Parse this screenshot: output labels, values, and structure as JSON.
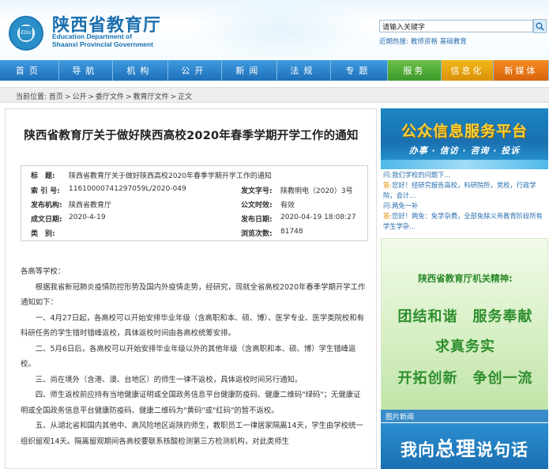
{
  "header": {
    "title_cn": "陕西省教育厅",
    "title_en_1": "Education Department of",
    "title_en_2": "Shaanxi Provincial Government",
    "search_placeholder": "请输入关键字",
    "hot_label": "近期热搜:",
    "hot_links": [
      "教师资格",
      "基础教育"
    ]
  },
  "nav": [
    {
      "label": "首页"
    },
    {
      "label": "导航"
    },
    {
      "label": "机构"
    },
    {
      "label": "公开"
    },
    {
      "label": "新闻"
    },
    {
      "label": "法规"
    },
    {
      "label": "专题"
    },
    {
      "label": "服务"
    },
    {
      "label": "信息化"
    },
    {
      "label": "新媒体"
    }
  ],
  "breadcrumb": {
    "prefix": "当前位置:",
    "items": [
      "首页",
      "公开",
      "委厅文件",
      "教育厅文件",
      "正文"
    ],
    "sep": ">"
  },
  "article": {
    "title": "陕西省教育厅关于做好陕西高校2020年春季学期开学工作的通知",
    "meta": {
      "title_label": "标　题:",
      "title_value": "陕西省教育厅关于做好陕西高校2020年春季学期开学工作的通知",
      "index_label": "索 引 号:",
      "index_value": "11610000741297059L/2020-049",
      "doc_no_label": "发文字号:",
      "doc_no_value": "陕教明电（2020）3号",
      "issuer_label": "发布机构:",
      "issuer_value": "陕西省教育厅",
      "validity_label": "公文时效:",
      "validity_value": "有效",
      "created_label": "成文日期:",
      "created_value": "2020-4-19",
      "published_label": "发布日期:",
      "published_value": "2020-04-19 18:08:27",
      "category_label": "类　别:",
      "category_value": "",
      "views_label": "浏览次数:",
      "views_value": "81748"
    },
    "paragraphs": [
      "各高等学校：",
      "根据我省新冠肺炎疫情防控形势及国内外疫情走势，经研究，现就全省高校2020年春季学期开学工作通知如下：",
      "一、4月27日起，各高校可以开始安排毕业年级（含高职和本、硕、博）、医学专业、医学类院校和有科研任务的学生错时错峰返校，具体返校时间由各高校统筹安排。",
      "二、5月6日后，各高校可以开始安排毕业年级以外的其他年级（含高职和本、硕、博）学生错峰返校。",
      "三、尚在境外（含港、澳、台地区）的师生一律不返校，具体返校时间另行通知。",
      "四、师生返校前应持有当地健康证明或全国政务信息平台健康防疫码、健康二维码\"绿码\"；无健康证明或全国政务信息平台健康防疫码、健康二维码为\"黄码\"或\"红码\"的暂不返校。",
      "五、从湖北省和国内其他中、高风险地区返陕的师生，教职员工一律居家隔离14天，学生由学校统一组织留观14天。隔离留观期间各高校要联系核酸检测第三方检测机构，对此类师生"
    ]
  },
  "sidebar": {
    "service_title": "公众信息服务平台",
    "service_sub": "办事 · 信访 · 咨询 · 投诉",
    "qa": [
      {
        "kind": "q",
        "prefix": "问:",
        "text": "我们学校的问题下..."
      },
      {
        "kind": "a",
        "prefix": "答:",
        "text": "您好！经研究报告高校，科研院所，党校，行政学院，会计..."
      },
      {
        "kind": "q",
        "prefix": "问:",
        "text": "两免一补"
      },
      {
        "kind": "a",
        "prefix": "答:",
        "text": "您好！两免：免学杂费，全部免除义务教育阶段所有学生学杂..."
      }
    ],
    "spirit_title": "陕西省教育厅机关精神:",
    "spirit_lines": [
      "团结和谐　服务奉献",
      "求真务实",
      "开拓创新　争创一流"
    ],
    "pic_news_label": "图片新闻",
    "talk_text_pre": "我向",
    "talk_text_big": "总理",
    "talk_text_post": "说句话"
  }
}
